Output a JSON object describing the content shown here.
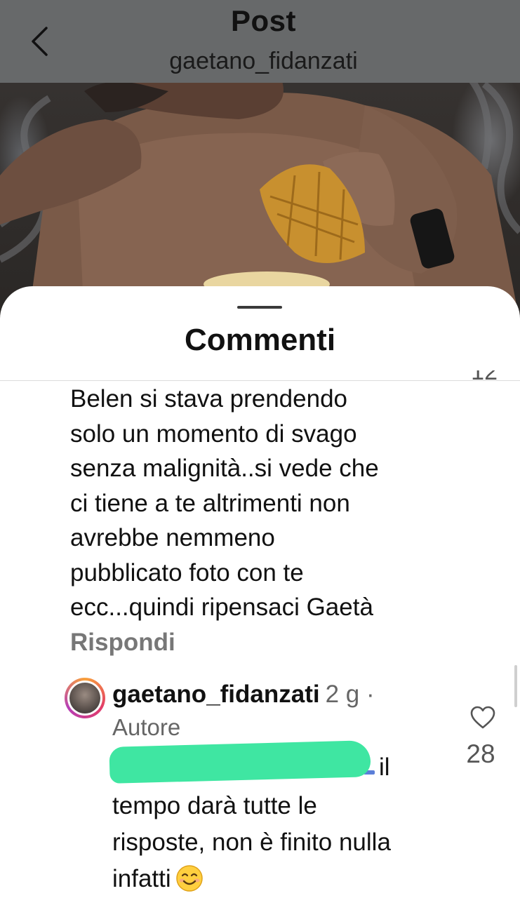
{
  "header": {
    "title": "Post",
    "subtitle": "gaetano_fidanzati",
    "back_icon": "chevron-left-icon",
    "background": "#67696a"
  },
  "sheet": {
    "title": "Commenti"
  },
  "comment": {
    "text": "Belen si stava prendendo\nsolo un momento di svago\nsenza malignità..si vede che\nci tiene a te altrimenti non\navrebbe nemmeno\npubblicato foto con te\necc...quindi ripensaci Gaetà",
    "like_count_partial": "12",
    "reply_label": "Rispondi"
  },
  "reply": {
    "username": "gaetano_fidanzati",
    "time": "2 g ·",
    "role": "Autore",
    "text_first_line_visible": "il",
    "text_rest": "tempo darà tutte le\nrisposte, non è finito nulla\ninfatti",
    "emoji": "smiling-face-icon",
    "like_icon": "heart-outline-icon",
    "like_count": "28",
    "redaction_color": "#3fe6a2"
  }
}
